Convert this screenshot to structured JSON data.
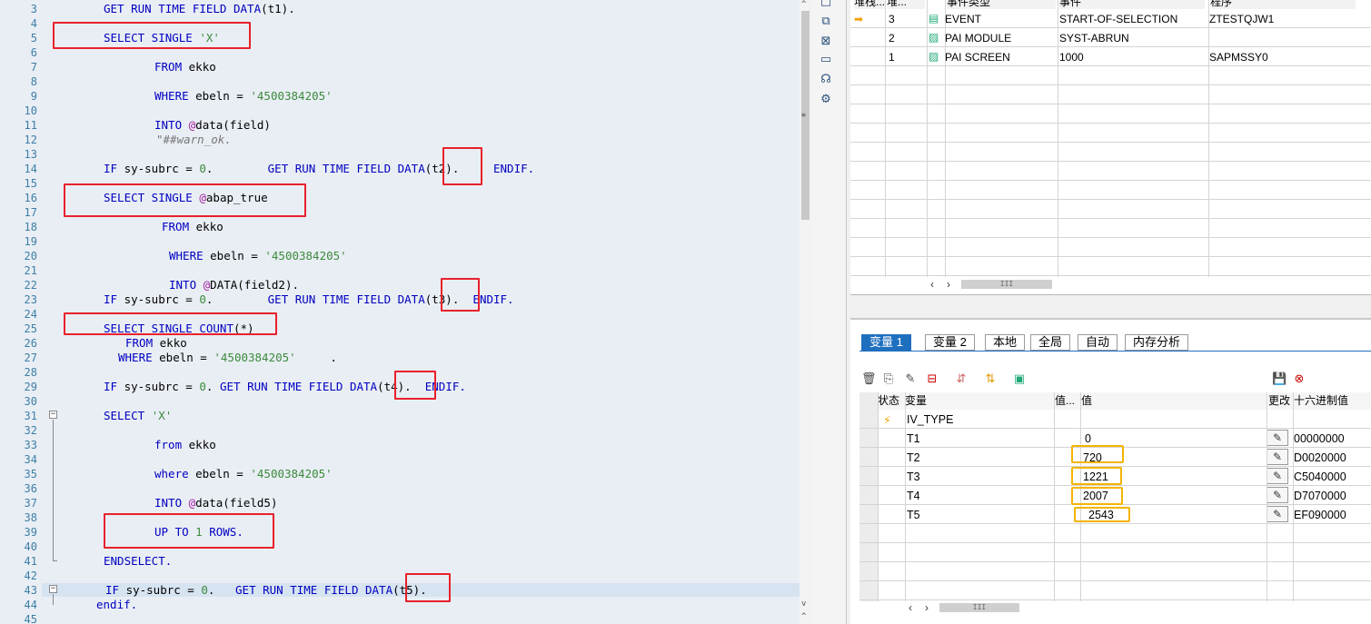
{
  "editor": {
    "line_numbers": [
      "3",
      "4",
      "5",
      "6",
      "7",
      "8",
      "9",
      "10",
      "11",
      "12",
      "13",
      "14",
      "15",
      "16",
      "17",
      "18",
      "19",
      "20",
      "21",
      "22",
      "23",
      "24",
      "25",
      "26",
      "27",
      "28",
      "29",
      "30",
      "31",
      "32",
      "33",
      "34",
      "35",
      "36",
      "37",
      "38",
      "39",
      "40",
      "41",
      "42",
      "43",
      "44",
      "45"
    ],
    "lines": [
      {
        "n": "3",
        "parts": [
          [
            "kw",
            "GET RUN TIME FIELD DATA"
          ],
          [
            "",
            "(t1)."
          ]
        ]
      },
      {
        "n": "5",
        "parts": [
          [
            "kw",
            "SELECT SINGLE "
          ],
          [
            "str",
            "'X'"
          ]
        ]
      },
      {
        "n": "7",
        "parts": [
          [
            "kw",
            "FROM "
          ],
          [
            "",
            "ekko"
          ]
        ]
      },
      {
        "n": "9",
        "parts": [
          [
            "kw",
            "WHERE "
          ],
          [
            "",
            "ebeln = "
          ],
          [
            "str",
            "'4500384205'"
          ]
        ]
      },
      {
        "n": "11",
        "parts": [
          [
            "kw",
            "INTO "
          ],
          [
            "at",
            "@"
          ],
          [
            "",
            "data(field)"
          ]
        ]
      },
      {
        "n": "12",
        "parts": [
          [
            "cmt",
            "\"##warn_ok."
          ]
        ]
      },
      {
        "n": "14",
        "parts": [
          [
            "kw",
            "IF "
          ],
          [
            "",
            "sy-subrc = "
          ],
          [
            "num",
            "0"
          ],
          [
            "",
            "."
          ],
          [
            "kw",
            "        GET RUN TIME FIELD DATA"
          ],
          [
            "",
            "(t2)."
          ],
          [
            "kw",
            "     ENDIF."
          ]
        ]
      },
      {
        "n": "16",
        "parts": [
          [
            "kw",
            "SELECT SINGLE "
          ],
          [
            "at",
            "@"
          ],
          [
            "",
            "abap_true"
          ]
        ]
      },
      {
        "n": "18",
        "parts": [
          [
            "kw",
            "FROM "
          ],
          [
            "",
            "ekko"
          ]
        ]
      },
      {
        "n": "20",
        "parts": [
          [
            "kw",
            "WHERE "
          ],
          [
            "",
            "ebeln = "
          ],
          [
            "str",
            "'4500384205'"
          ]
        ]
      },
      {
        "n": "22",
        "parts": [
          [
            "kw",
            "INTO "
          ],
          [
            "at",
            "@"
          ],
          [
            "",
            "DATA(field2)."
          ]
        ]
      },
      {
        "n": "23",
        "parts": [
          [
            "kw",
            "IF "
          ],
          [
            "",
            "sy-subrc = "
          ],
          [
            "num",
            "0"
          ],
          [
            "",
            "."
          ],
          [
            "kw",
            "        GET RUN TIME FIELD DATA"
          ],
          [
            "",
            "(t3)."
          ],
          [
            "kw",
            "  ENDIF."
          ]
        ]
      },
      {
        "n": "25",
        "parts": [
          [
            "kw",
            "SELECT SINGLE COUNT"
          ],
          [
            "",
            "(*)"
          ]
        ]
      },
      {
        "n": "26",
        "parts": [
          [
            "kw",
            "FROM "
          ],
          [
            "",
            "ekko"
          ]
        ]
      },
      {
        "n": "27",
        "parts": [
          [
            "kw",
            "WHERE "
          ],
          [
            "",
            "ebeln = "
          ],
          [
            "str",
            "'4500384205'"
          ],
          [
            "",
            "     ."
          ]
        ]
      },
      {
        "n": "29",
        "parts": [
          [
            "kw",
            "IF "
          ],
          [
            "",
            "sy-subrc = "
          ],
          [
            "num",
            "0"
          ],
          [
            "",
            "."
          ],
          [
            "kw",
            " GET RUN TIME FIELD DATA"
          ],
          [
            "",
            "(t4)."
          ],
          [
            "kw",
            "  ENDIF."
          ]
        ]
      },
      {
        "n": "31",
        "parts": [
          [
            "kw",
            "SELECT "
          ],
          [
            "str",
            "'X'"
          ]
        ]
      },
      {
        "n": "33",
        "parts": [
          [
            "kw",
            "from "
          ],
          [
            "",
            "ekko"
          ]
        ]
      },
      {
        "n": "35",
        "parts": [
          [
            "kw",
            "where "
          ],
          [
            "",
            "ebeln = "
          ],
          [
            "str",
            "'4500384205'"
          ]
        ]
      },
      {
        "n": "37",
        "parts": [
          [
            "kw",
            "INTO "
          ],
          [
            "at",
            "@"
          ],
          [
            "",
            "data(field5)"
          ]
        ]
      },
      {
        "n": "39",
        "parts": [
          [
            "kw",
            "UP TO "
          ],
          [
            "num",
            "1"
          ],
          [
            "kw",
            " ROWS."
          ]
        ]
      },
      {
        "n": "41",
        "parts": [
          [
            "kw",
            "ENDSELECT."
          ]
        ]
      },
      {
        "n": "43",
        "parts": [
          [
            "kw",
            "IF "
          ],
          [
            "",
            "sy-subrc = "
          ],
          [
            "num",
            "0"
          ],
          [
            "",
            "."
          ],
          [
            "kw",
            "   GET RUN TIME FIELD DATA"
          ],
          [
            "",
            "(t5)."
          ]
        ]
      },
      {
        "n": "44",
        "parts": [
          [
            "kw",
            "endif."
          ]
        ]
      }
    ]
  },
  "stack": {
    "headers": [
      "堆栈...",
      "堆...",
      "事件类型",
      "事件",
      "程序"
    ],
    "rows": [
      {
        "level": "3",
        "type": "EVENT",
        "event": "START-OF-SELECTION",
        "program": "ZTESTQJW1",
        "current": true
      },
      {
        "level": "2",
        "type": "PAI MODULE",
        "event": "SYST-ABRUN",
        "program": "",
        "current": false
      },
      {
        "level": "1",
        "type": "PAI SCREEN",
        "event": "1000",
        "program": "SAPMSSY0",
        "current": false
      }
    ],
    "nav": [
      "‹",
      "›",
      "III"
    ]
  },
  "variables": {
    "tabs": [
      "变量 1",
      "变量 2",
      "本地",
      "全局",
      "自动",
      "内存分析"
    ],
    "active_tab": "变量 1",
    "headers": [
      "状态",
      "变量",
      "值...",
      "值",
      "更改",
      "十六进制值"
    ],
    "rows": [
      {
        "name": "IV_TYPE",
        "value": "",
        "hex": "",
        "editable": false,
        "status": "⚡"
      },
      {
        "name": "T1",
        "value": "0",
        "hex": "00000000",
        "editable": true,
        "status": ""
      },
      {
        "name": "T2",
        "value": "720",
        "hex": "D0020000",
        "editable": true,
        "status": ""
      },
      {
        "name": "T3",
        "value": "1221",
        "hex": "C5040000",
        "editable": true,
        "status": ""
      },
      {
        "name": "T4",
        "value": "2007",
        "hex": "D7070000",
        "editable": true,
        "status": ""
      },
      {
        "name": "T5",
        "value": "2543",
        "hex": "EF090000",
        "editable": true,
        "status": ""
      }
    ],
    "nav": [
      "‹",
      "›",
      "III"
    ]
  },
  "colors": {
    "highlight_red": "#e8212b",
    "highlight_yellow": "#f4b400",
    "active_tab": "#1f6fbf",
    "keyword": "#0000c0",
    "string": "#3c8a3c"
  }
}
